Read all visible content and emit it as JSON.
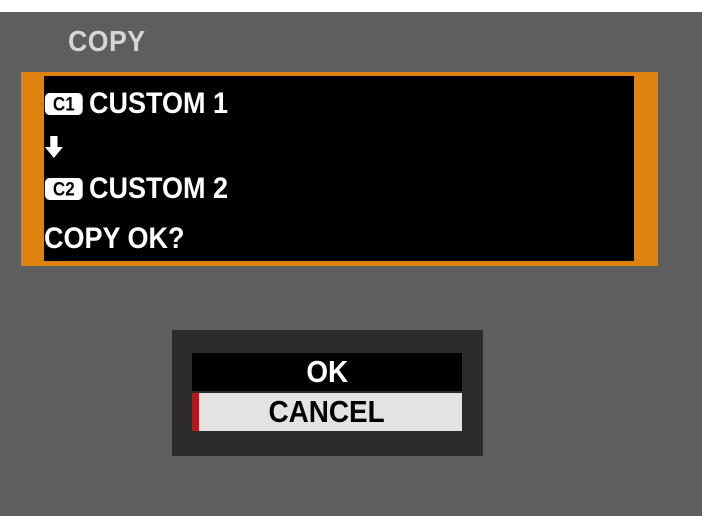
{
  "screen": {
    "title": "COPY"
  },
  "message": {
    "source": {
      "icon": "custom-1-badge-icon",
      "badge_text": "C1",
      "label": "CUSTOM 1"
    },
    "arrow_icon": "down-arrow-icon",
    "destination": {
      "icon": "custom-2-badge-icon",
      "badge_text": "C2",
      "label": "CUSTOM 2"
    },
    "prompt": "COPY OK?"
  },
  "dialog": {
    "options": [
      {
        "label": "OK",
        "selected": false
      },
      {
        "label": "CANCEL",
        "selected": true
      }
    ]
  },
  "colors": {
    "background": "#5e5e5e",
    "accent_frame": "#e0820f",
    "selection_bar": "#b31a1a",
    "selected_option_bg": "#e3e3e3"
  }
}
